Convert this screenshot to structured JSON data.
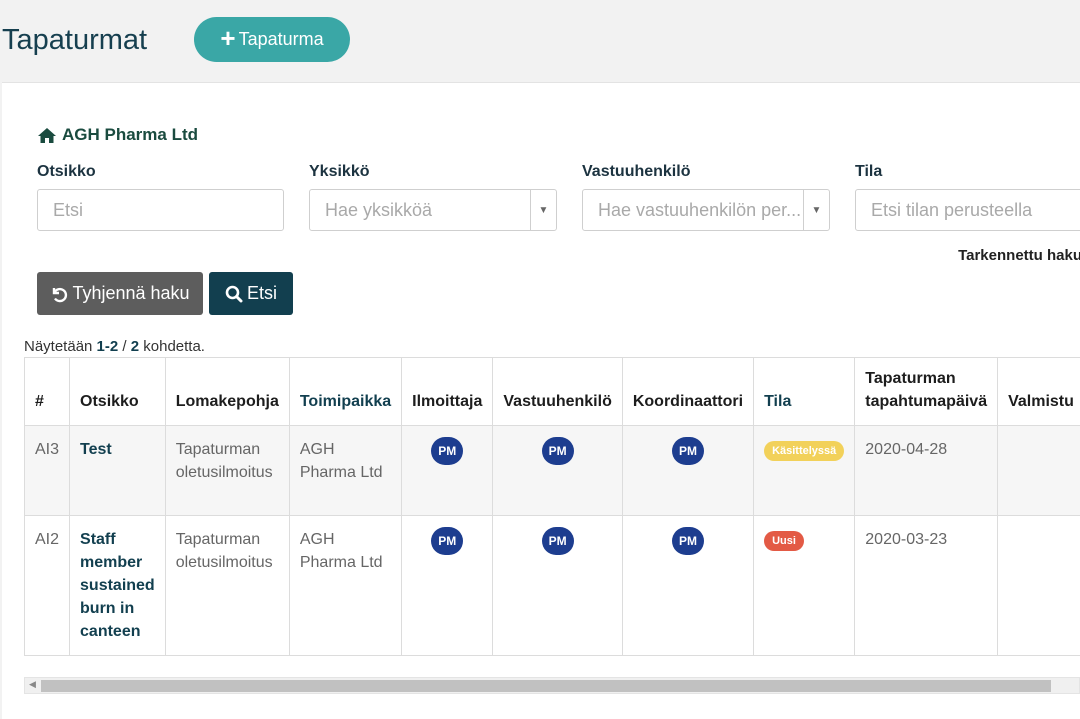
{
  "header": {
    "title": "Tapaturmat",
    "add_button": "Tapaturma"
  },
  "organization": "AGH Pharma Ltd",
  "filters": [
    {
      "label": "Otsikko",
      "placeholder": "Etsi"
    },
    {
      "label": "Yksikkö",
      "placeholder": "Hae yksikköä"
    },
    {
      "label": "Vastuuhenkilö",
      "placeholder": "Hae vastuuhenkilön per..."
    },
    {
      "label": "Tila",
      "placeholder": "Etsi tilan perusteella"
    }
  ],
  "advanced_search": "Tarkennettu haku",
  "buttons": {
    "clear": "Tyhjennä haku",
    "search": "Etsi"
  },
  "results": {
    "prefix": "Näytetään ",
    "range": "1-2",
    "separator": " / ",
    "total": "2",
    "suffix": " kohdetta."
  },
  "table": {
    "columns": [
      "#",
      "Otsikko",
      "Lomakepohja",
      "Toimipaikka",
      "Ilmoittaja",
      "Vastuuhenkilö",
      "Koordinaattori",
      "Tila",
      "Tapaturman tapahtumapäivä",
      "Valmistu"
    ],
    "rows": [
      {
        "id": "AI3",
        "title": "Test",
        "template": "Tapaturman oletusilmoitus",
        "location": "AGH Pharma Ltd",
        "reporter": "PM",
        "responsible": "PM",
        "coordinator": "PM",
        "status": "Käsittelyssä",
        "date": "2020-04-28",
        "completed": ""
      },
      {
        "id": "AI2",
        "title": "Staff member sustained burn in canteen",
        "template": "Tapaturman oletusilmoitus",
        "location": "AGH Pharma Ltd",
        "reporter": "PM",
        "responsible": "PM",
        "coordinator": "PM",
        "status": "Uusi",
        "date": "2020-03-23",
        "completed": ""
      }
    ]
  },
  "colors": {
    "accent": "#3aa7a6",
    "primary_dark": "#123f4f",
    "avatar": "#1d3d8f",
    "status_processing": "#f2d15a",
    "status_new": "#e35a45"
  }
}
